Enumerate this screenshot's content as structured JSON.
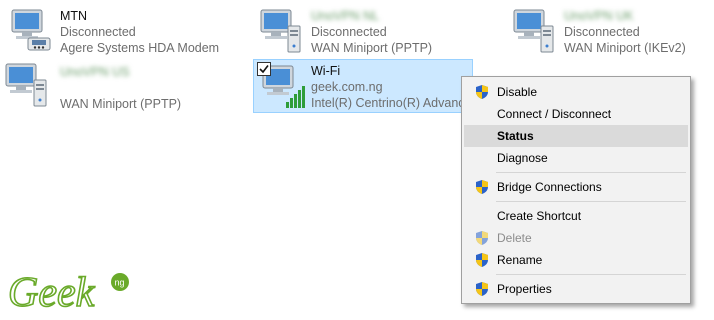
{
  "connections": [
    {
      "id": "mtn",
      "name": "MTN",
      "status": "Disconnected",
      "device": "Agere Systems HDA Modem",
      "icon": "modem-network-icon"
    },
    {
      "id": "vpn1",
      "name": "UnoVPN NL",
      "status": "Disconnected",
      "device": "WAN Miniport (PPTP)",
      "icon": "vpn-network-icon"
    },
    {
      "id": "vpn2",
      "name": "UnoVPN UK",
      "status": "Disconnected",
      "device": "WAN Miniport (IKEv2)",
      "icon": "vpn-network-icon"
    },
    {
      "id": "vpn3",
      "name": "UnoVPN US",
      "device": "WAN Miniport (PPTP)",
      "icon": "vpn-network-icon"
    },
    {
      "id": "wifi",
      "name": "Wi-Fi",
      "status": "geek.com.ng",
      "device": "Intel(R) Centrino(R) Advance",
      "icon": "wifi-network-icon",
      "selected": true
    }
  ],
  "menu": {
    "items": [
      {
        "label": "Disable",
        "shield": true
      },
      {
        "label": "Connect / Disconnect",
        "shield": false
      },
      {
        "label": "Status",
        "shield": false,
        "bold": true,
        "highlighted": true
      },
      {
        "label": "Diagnose",
        "shield": false
      },
      {
        "label": "Bridge Connections",
        "shield": true
      },
      {
        "label": "Create Shortcut",
        "shield": false
      },
      {
        "label": "Delete",
        "shield": true,
        "disabled": true
      },
      {
        "label": "Rename",
        "shield": true
      },
      {
        "label": "Properties",
        "shield": true
      }
    ]
  },
  "logo": {
    "text": "Geek",
    "badge": "ng"
  },
  "colors": {
    "selection_bg": "#cce8ff",
    "selection_border": "#99d1ff",
    "menu_bg": "#f2f2f2",
    "menu_highlight": "#dadada",
    "logo_green": "#6aaa2a"
  }
}
